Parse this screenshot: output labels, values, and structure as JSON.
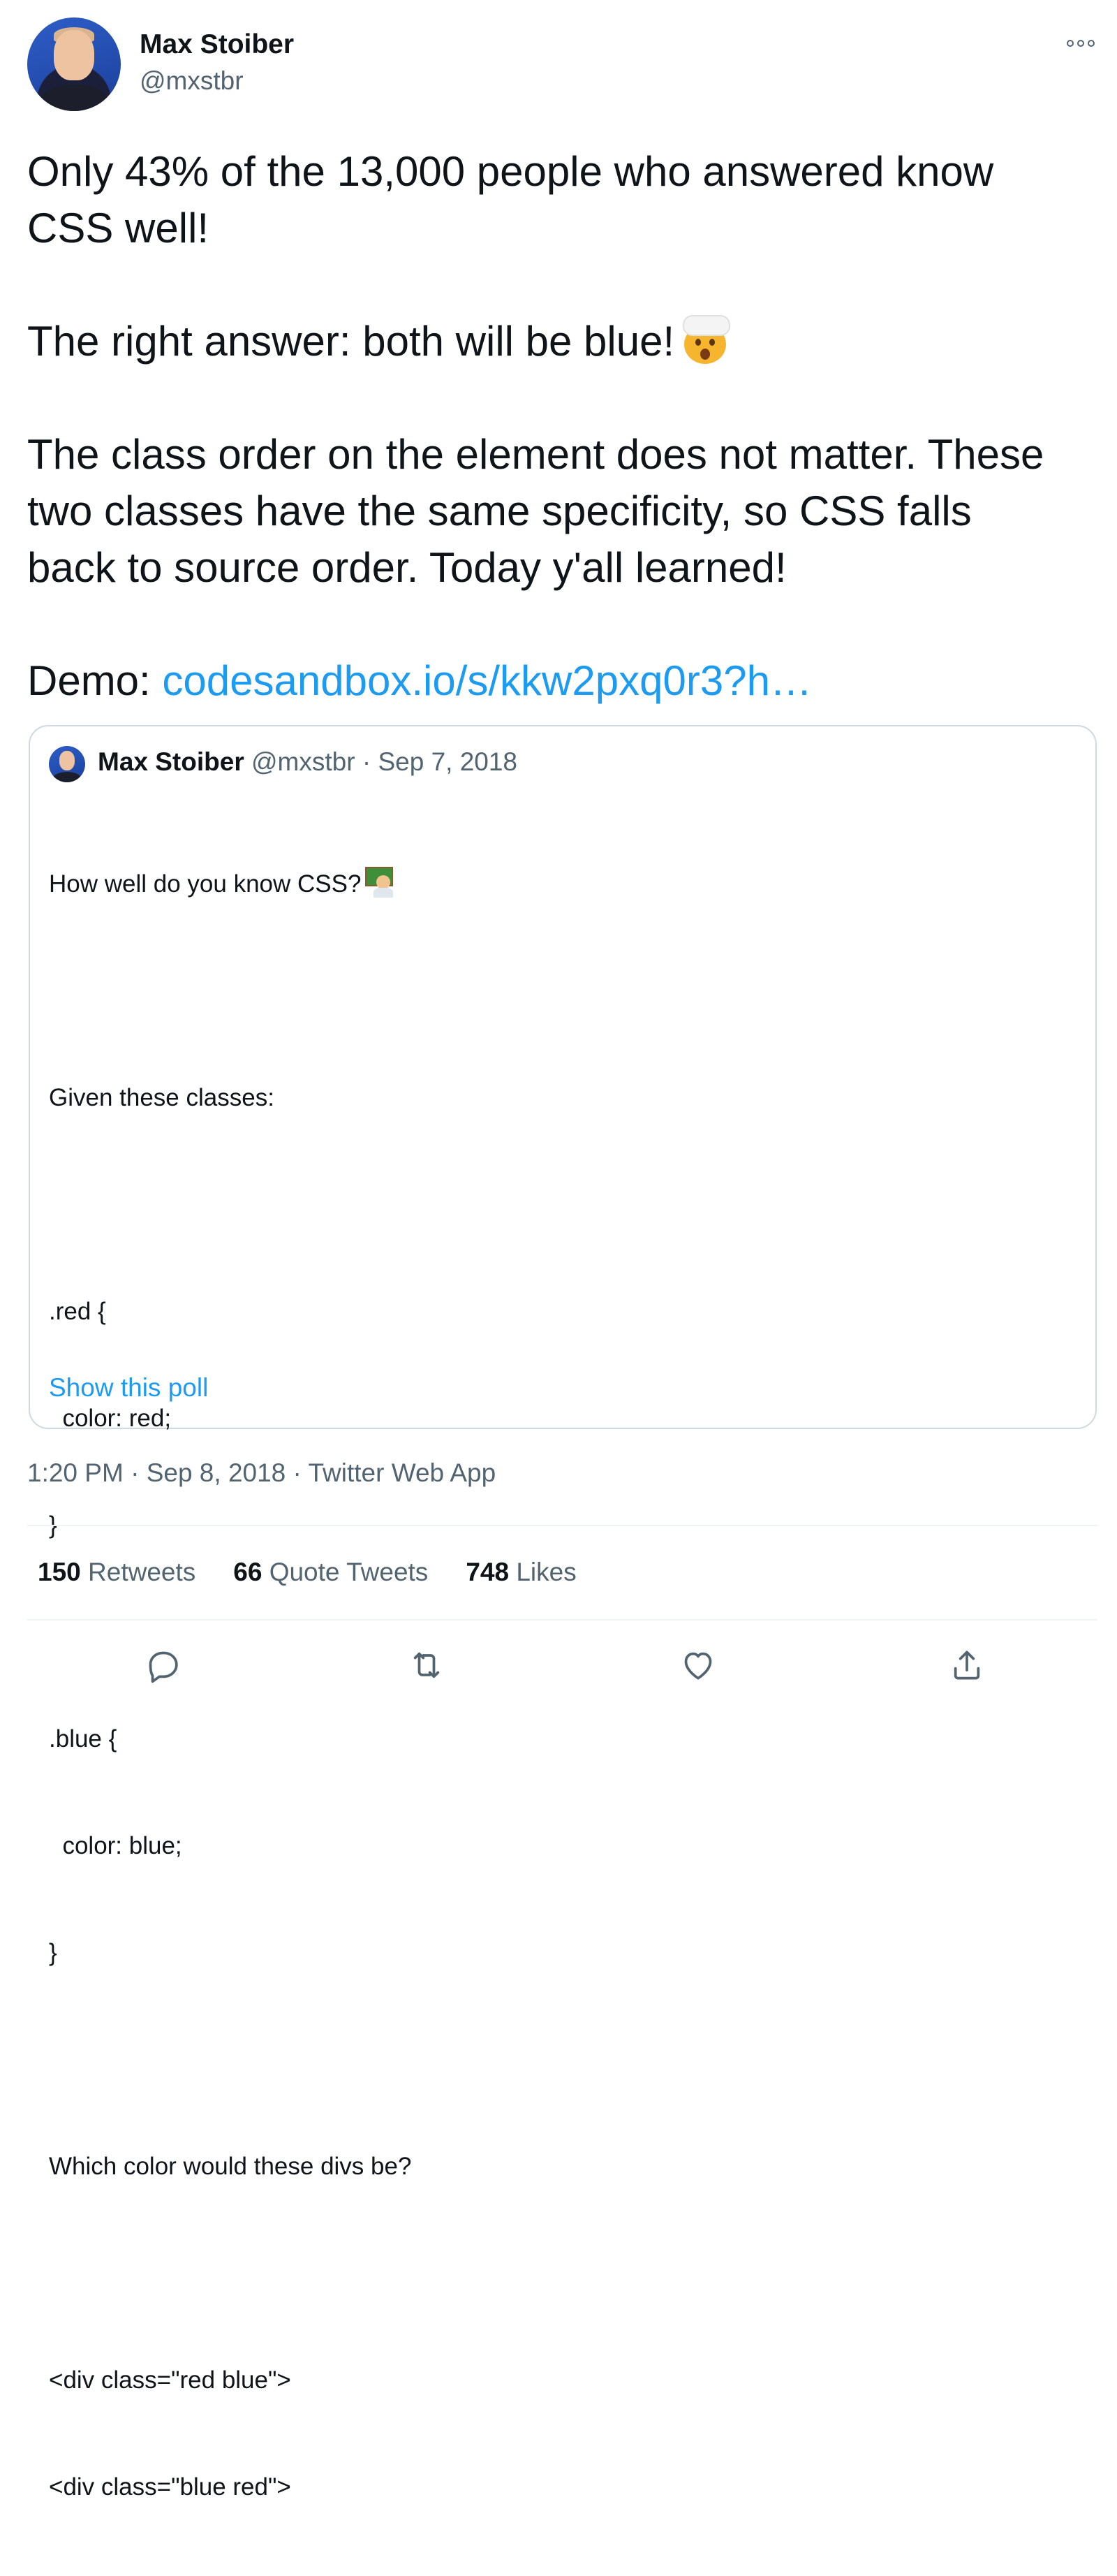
{
  "author": {
    "name": "Max Stoiber",
    "handle": "@mxstbr"
  },
  "tweet": {
    "line1": "Only 43% of the 13,000 people who answered know",
    "line2": "CSS well!",
    "answer": "The right answer: both will be blue!",
    "answer_emoji": "exploding-head-icon",
    "explain1": "The class order on the element does not matter. These",
    "explain2": "two classes have the same specificity, so CSS falls",
    "explain3": "back to source order. Today y'all learned!",
    "demo_label": "Demo: ",
    "demo_link": "codesandbox.io/s/kkw2pxq0r3?h…"
  },
  "quoted": {
    "name": "Max Stoiber",
    "handle": "@mxstbr",
    "sep": " · ",
    "date": "Sep 7, 2018",
    "title": "How well do you know CSS?",
    "title_emoji": "teacher-icon",
    "lines": [
      "",
      "Given these classes:",
      "",
      ".red {",
      "  color: red;",
      "}",
      "",
      ".blue {",
      "  color: blue;",
      "}",
      "",
      "Which color would these divs be?",
      "",
      "<div class=\"red blue\">",
      "<div class=\"blue red\">"
    ],
    "show_poll": "Show this poll"
  },
  "meta": {
    "time": "1:20 PM",
    "sep1": " · ",
    "date": "Sep 8, 2018",
    "sep2": " · ",
    "source": "Twitter Web App"
  },
  "stats": {
    "retweets_count": "150",
    "retweets_label": "Retweets",
    "quotes_count": "66",
    "quotes_label": "Quote Tweets",
    "likes_count": "748",
    "likes_label": "Likes"
  },
  "actions": [
    "reply-icon",
    "retweet-icon",
    "like-icon",
    "share-icon"
  ],
  "colors": {
    "link": "#1d9bf0",
    "secondary_text": "#536471",
    "primary_text": "#0f1419",
    "border": "#cfd9de"
  }
}
